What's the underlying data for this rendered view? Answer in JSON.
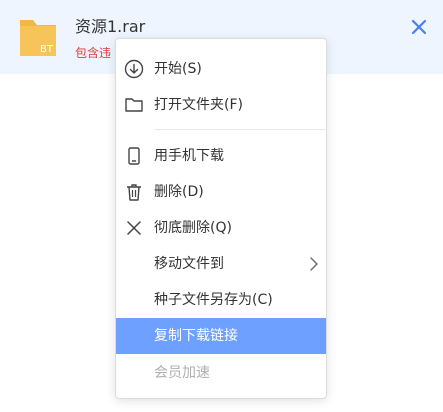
{
  "file": {
    "name": "资源1.rar",
    "badge": "BT",
    "subtext": "包含违"
  },
  "menu": {
    "start": "开始(S)",
    "open_folder": "打开文件夹(F)",
    "open_on_phone": "用手机下载",
    "delete": "删除(D)",
    "delete_permanently": "彻底删除(Q)",
    "move_file_to": "移动文件到",
    "save_torrent_as": "种子文件另存为(C)",
    "copy_download_link": "复制下载链接",
    "vip_speedup": "会员加速"
  },
  "colors": {
    "header_bg": "#eef5ff",
    "highlight": "#6ea0ff",
    "folder": "#f7c45a",
    "close": "#4a7cf0",
    "warning_text": "#e03a3a"
  }
}
